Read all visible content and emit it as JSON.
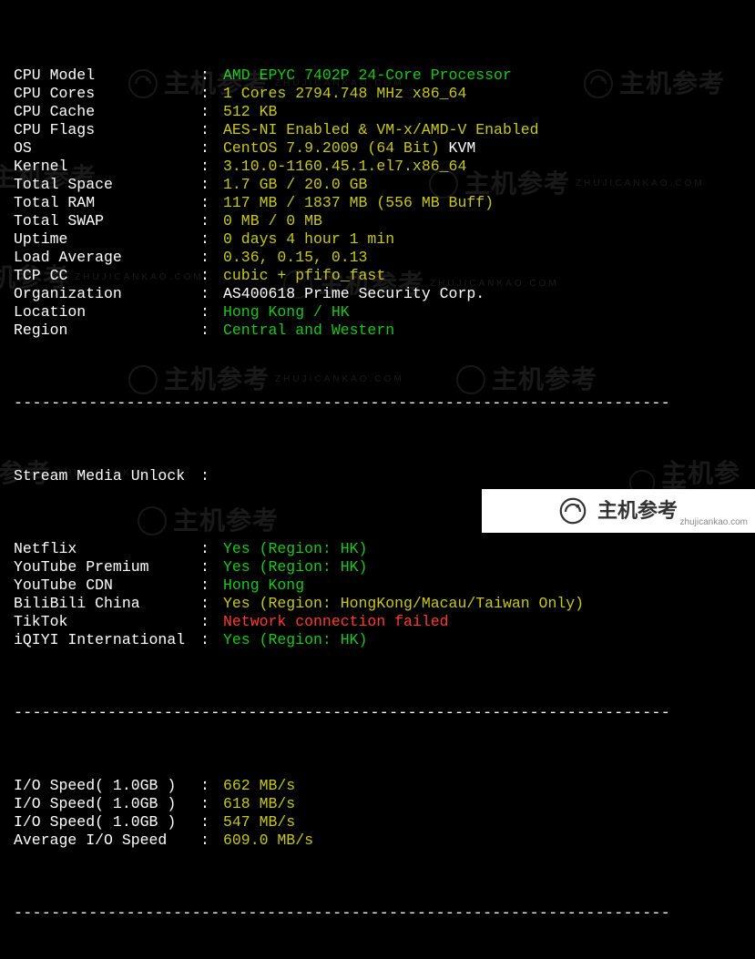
{
  "sysinfo": [
    {
      "label": "CPU Model",
      "value": "AMD EPYC 7402P 24-Core Processor",
      "cls": "green"
    },
    {
      "label": "CPU Cores",
      "value": "1 Cores 2794.748 MHz x86_64",
      "cls": "yellow"
    },
    {
      "label": "CPU Cache",
      "value": "512 KB",
      "cls": "yellow"
    },
    {
      "label": "CPU Flags",
      "value": "AES-NI Enabled & VM-x/AMD-V Enabled",
      "cls": "yellow"
    },
    {
      "label": "OS",
      "value_a": "CentOS 7.9.2009 (64 Bit)",
      "cls_a": "yellow",
      "value_b": " KVM",
      "cls_b": "white"
    },
    {
      "label": "Kernel",
      "value": "3.10.0-1160.45.1.el7.x86_64",
      "cls": "yellow"
    },
    {
      "label": "Total Space",
      "value": "1.7 GB / 20.0 GB",
      "cls": "yellow"
    },
    {
      "label": "Total RAM",
      "value": "117 MB / 1837 MB (556 MB Buff)",
      "cls": "yellow"
    },
    {
      "label": "Total SWAP",
      "value": "0 MB / 0 MB",
      "cls": "yellow"
    },
    {
      "label": "Uptime",
      "value": "0 days 4 hour 1 min",
      "cls": "yellow"
    },
    {
      "label": "Load Average",
      "value": "0.36, 0.15, 0.13",
      "cls": "yellow"
    },
    {
      "label": "TCP CC",
      "value": "cubic + pfifo_fast",
      "cls": "yellow"
    },
    {
      "label": "Organization",
      "value": "AS400618 Prime Security Corp.",
      "cls": "white"
    },
    {
      "label": "Location",
      "value": "Hong Kong / HK",
      "cls": "green"
    },
    {
      "label": "Region",
      "value": "Central and Western",
      "cls": "green"
    }
  ],
  "stream_header": "Stream Media Unlock",
  "stream": [
    {
      "label": "Netflix",
      "value": "Yes (Region: HK)",
      "cls": "green"
    },
    {
      "label": "YouTube Premium",
      "value": "Yes (Region: HK)",
      "cls": "green"
    },
    {
      "label": "YouTube CDN",
      "value": "Hong Kong",
      "cls": "green"
    },
    {
      "label": "BiliBili China",
      "value": "Yes (Region: HongKong/Macau/Taiwan Only)",
      "cls": "yellow"
    },
    {
      "label": "TikTok",
      "value": "Network connection failed",
      "cls": "red"
    },
    {
      "label": "iQIYI International",
      "value": "Yes (Region: HK)",
      "cls": "green"
    }
  ],
  "io": [
    {
      "label": "I/O Speed( 1.0GB )",
      "value": "662 MB/s",
      "cls": "yellow"
    },
    {
      "label": "I/O Speed( 1.0GB )",
      "value": "618 MB/s",
      "cls": "yellow"
    },
    {
      "label": "I/O Speed( 1.0GB )",
      "value": "547 MB/s",
      "cls": "yellow"
    },
    {
      "label": "Average I/O Speed",
      "value": "609.0 MB/s",
      "cls": "yellow"
    }
  ],
  "colon": ":",
  "watermark": {
    "cn": "主机参考",
    "en": "ZHUJICANKAO.COM",
    "url": "zhujicankao.com"
  }
}
